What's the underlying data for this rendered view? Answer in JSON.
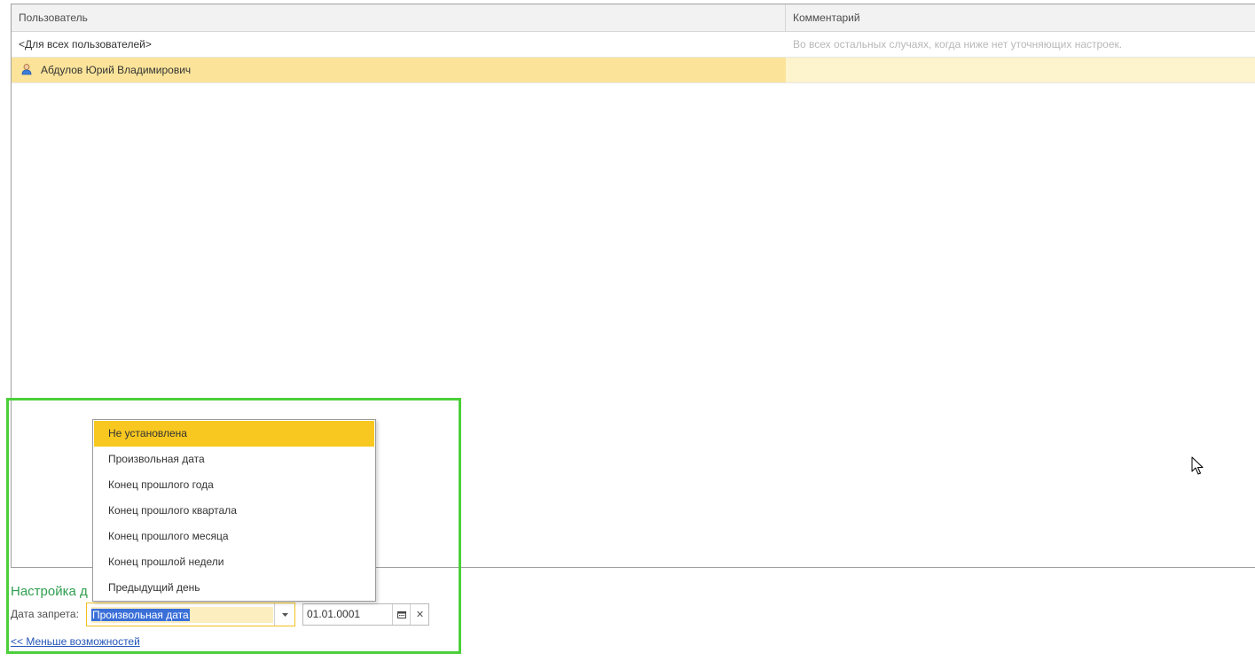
{
  "table": {
    "columns": {
      "user": "Пользователь",
      "comment": "Комментарий"
    },
    "rows": [
      {
        "user": "<Для всех пользователей>",
        "comment": "Во всех остальных случаях, когда ниже нет уточняющих настроек."
      },
      {
        "user": "Абдулов Юрий Владимирович",
        "comment": "",
        "icon": "user-icon"
      }
    ]
  },
  "settings": {
    "title": "Настройка д",
    "date_label": "Дата запрета:",
    "combo_value": "Произвольная дата",
    "date_value": "01.01.0001",
    "less_link": "<< Меньше возможностей"
  },
  "dropdown": {
    "items": [
      "Не установлена",
      "Произвольная дата",
      "Конец прошлого года",
      "Конец прошлого квартала",
      "Конец прошлого месяца",
      "Конец прошлой недели",
      "Предыдущий день"
    ],
    "active_index": 0
  },
  "colors": {
    "highlight_border": "#4ccf3a",
    "selected_row": "#fbe49a",
    "active_item": "#f8c820",
    "section_title": "#2e9e4f",
    "link": "#2456b8"
  }
}
